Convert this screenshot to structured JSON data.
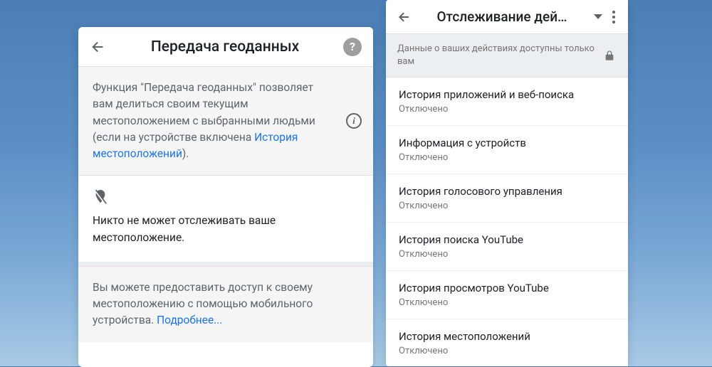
{
  "left_screen": {
    "header_title": "Передача геоданных",
    "info_card": {
      "text_prefix": "Функция \"Передача геоданных\" позволяет вам делиться своим текущим местоположением с выбранными людьми (если на устройстве включена ",
      "link_text": "История местоположений",
      "text_suffix": ")."
    },
    "status_card": "Никто не может отслеживать ваше местоположение.",
    "access_card": {
      "text": "Вы можете предоставить доступ к своему местоположению с помощью мобильного устройства. ",
      "link_text": "Подробнее..."
    }
  },
  "right_screen": {
    "header_title": "Отслеживание дей…",
    "privacy_banner": "Данные о ваших действиях доступны только вам",
    "settings": [
      {
        "title": "История приложений и веб-поиска",
        "status": "Отключено"
      },
      {
        "title": "Информация с устройств",
        "status": "Отключено"
      },
      {
        "title": "История голосового управления",
        "status": "Отключено"
      },
      {
        "title": "История поиска YouTube",
        "status": "Отключено"
      },
      {
        "title": "История просмотров YouTube",
        "status": "Отключено"
      },
      {
        "title": "История местоположений",
        "status": "Отключено"
      }
    ]
  }
}
